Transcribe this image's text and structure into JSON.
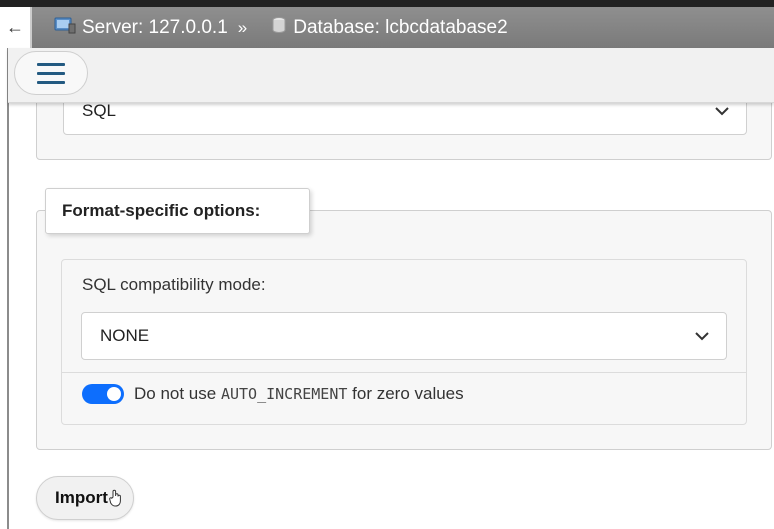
{
  "breadcrumb": {
    "server_label": "Server: 127.0.0.1",
    "separator": "»",
    "database_label": "Database: lcbcdatabase2",
    "server_icon": "server-icon",
    "database_icon": "database-icon"
  },
  "back": {
    "icon": "back-arrow-icon",
    "glyph": "←"
  },
  "menu": {
    "icon": "hamburger-icon"
  },
  "format_select": {
    "value": "SQL"
  },
  "format_options": {
    "legend": "Format-specific options:",
    "compat_label": "SQL compatibility mode:",
    "compat_value": "NONE",
    "toggle_text_before": "Do not use",
    "toggle_code": "AUTO_INCREMENT",
    "toggle_text_after": "for zero values",
    "toggle_checked": true
  },
  "actions": {
    "import_label": "Import"
  },
  "colors": {
    "accent": "#0d6efd",
    "hamburger": "#235a81",
    "topbar": "#858585"
  }
}
